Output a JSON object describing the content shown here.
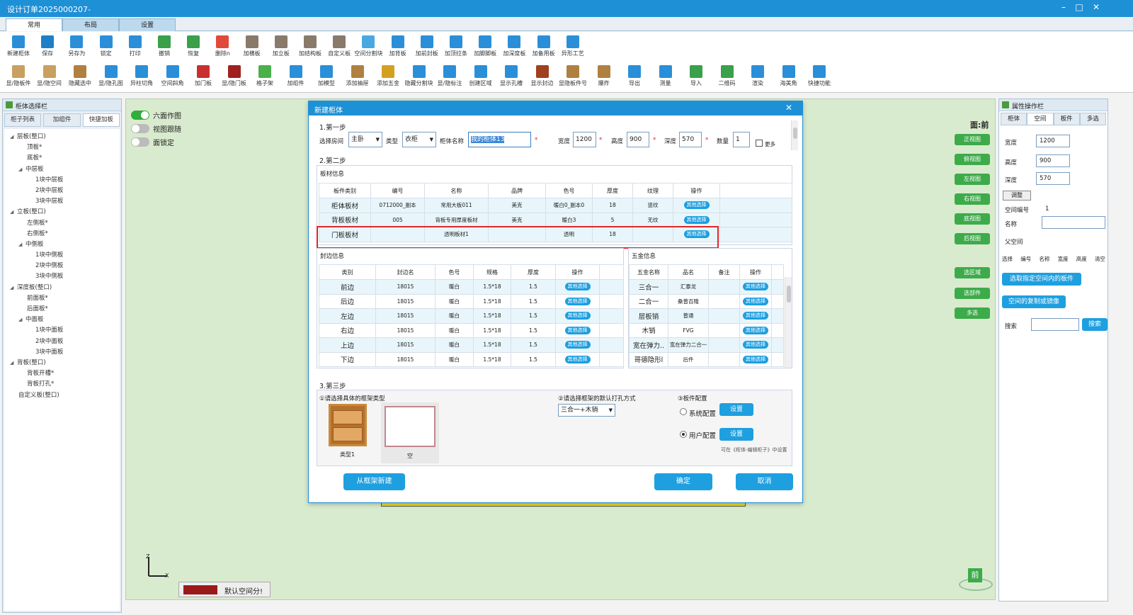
{
  "window": {
    "title": "设计订单2025000207-",
    "minimize": "–",
    "maximize": "□",
    "close": "✕"
  },
  "ribbon_tabs": [
    "常用",
    "布局",
    "设置"
  ],
  "toolbar_row1": [
    "新建柜体",
    "保存",
    "另存为",
    "锁定",
    "打印",
    "撤销",
    "恢复",
    "删除n",
    "加横板",
    "加立板",
    "加结构板",
    "自定义板",
    "空间分割块",
    "加背板",
    "加前封板",
    "加顶拉条",
    "加脚脚板",
    "加深度板",
    "加备用板",
    "异形工艺"
  ],
  "toolbar_row2": [
    "显/隐板件",
    "显/隐空间",
    "隐藏选中",
    "显/隐孔图",
    "异柱切角",
    "空间斜角",
    "加门板",
    "显/隐门板",
    "格子架",
    "加组件",
    "加模型",
    "添加抽屉",
    "添加五金",
    "隐藏分割块",
    "显/隐标注",
    "创建区域",
    "显示孔槽",
    "显示封边",
    "显隐板件号",
    "爆炸",
    "导出",
    "测量",
    "导入",
    "二维码",
    "渲染",
    "海美角",
    "快捷功能"
  ],
  "left_panel": {
    "title": "柜体选择栏",
    "tabs": [
      "柜子列表",
      "加组件",
      "快捷加板"
    ],
    "tree": [
      {
        "label": "层板(整口)",
        "lvl": 0,
        "ar": "◢"
      },
      {
        "label": "顶板*",
        "lvl": 2
      },
      {
        "label": "底板*",
        "lvl": 2
      },
      {
        "label": "中层板",
        "lvl": 1,
        "ar": "◢"
      },
      {
        "label": "1块中层板",
        "lvl": 3
      },
      {
        "label": "2块中层板",
        "lvl": 3
      },
      {
        "label": "3块中层板",
        "lvl": 3
      },
      {
        "label": "立板(整口)",
        "lvl": 0,
        "ar": "◢"
      },
      {
        "label": "左侧板*",
        "lvl": 2
      },
      {
        "label": "右侧板*",
        "lvl": 2
      },
      {
        "label": "中侧板",
        "lvl": 1,
        "ar": "◢"
      },
      {
        "label": "1块中侧板",
        "lvl": 3
      },
      {
        "label": "2块中侧板",
        "lvl": 3
      },
      {
        "label": "3块中侧板",
        "lvl": 3
      },
      {
        "label": "深度板(整口)",
        "lvl": 0,
        "ar": "◢"
      },
      {
        "label": "前面板*",
        "lvl": 2
      },
      {
        "label": "后面板*",
        "lvl": 2
      },
      {
        "label": "中面板",
        "lvl": 1,
        "ar": "◢"
      },
      {
        "label": "1块中面板",
        "lvl": 3
      },
      {
        "label": "2块中面板",
        "lvl": 3
      },
      {
        "label": "3块中面板",
        "lvl": 3
      },
      {
        "label": "背板(整口)",
        "lvl": 0,
        "ar": "◢"
      },
      {
        "label": "背板开槽*",
        "lvl": 2
      },
      {
        "label": "背板打孔*",
        "lvl": 2
      },
      {
        "label": "自定义板(整口)",
        "lvl": 1
      }
    ]
  },
  "view": {
    "switches": [
      {
        "label": "六面作图",
        "on": true
      },
      {
        "label": "视图跟随",
        "on": false
      },
      {
        "label": "面锁定",
        "on": false
      }
    ],
    "face_label": "面:前",
    "view_buttons": [
      "正视图",
      "俯视图",
      "左视图",
      "右视图",
      "底视图",
      "后视图"
    ],
    "select_buttons": [
      "选区域",
      "选部件",
      "多选"
    ],
    "axis_z": "Z",
    "axis_x": "X",
    "legend": "默认空间分!",
    "cube_label": "前"
  },
  "right_panel": {
    "title": "属性操作栏",
    "tabs": [
      "柜体",
      "空间",
      "板件",
      "多选"
    ],
    "width_label": "宽度",
    "width": "1200",
    "height_label": "高度",
    "height": "900",
    "depth_label": "深度",
    "depth": "570",
    "adjust_btn": "调整",
    "space_no_label": "空间编号",
    "space_no": "1",
    "name_label": "名称",
    "parent_label": "父空间",
    "cols": [
      "选择",
      "编号",
      "名称",
      "宽度",
      "高度",
      "清空"
    ],
    "btn_select_boards": "选取指定空间内的板件",
    "btn_copy": "空间的复制或镜像",
    "search_label": "搜索",
    "search_btn": "搜索"
  },
  "dialog": {
    "title": "新建柜体",
    "close": "✕",
    "step1": {
      "title": "1.第一步",
      "room_label": "选择房间",
      "room": "主卧",
      "type_label": "类型",
      "type": "衣柜",
      "name_label": "柜体名称",
      "name": "我的柜体13",
      "star": "*",
      "width_label": "宽度",
      "width": "1200",
      "height_label": "高度",
      "height": "900",
      "depth_label": "深度",
      "depth": "570",
      "qty_label": "数量",
      "qty": "1",
      "more_label": "更多"
    },
    "step2": {
      "title": "2.第二步",
      "board_title": "板材信息",
      "board_cols": [
        "板件类别",
        "编号",
        "名称",
        "品牌",
        "色号",
        "厚度",
        "纹理",
        "操作"
      ],
      "board_rows": [
        [
          "柜体板材",
          "0712000_副本",
          "常用大板011",
          "美克",
          "暖白0_副本0",
          "18",
          "竖纹",
          "其他选择"
        ],
        [
          "背板板材",
          "005",
          "背板专用厚度板材",
          "美克",
          "暖白3",
          "5",
          "无纹",
          "其他选择"
        ],
        [
          "门板板材",
          "",
          "透明板材1",
          "",
          "透明",
          "18",
          "",
          "其他选择"
        ]
      ],
      "edge_title": "封边信息",
      "edge_cols": [
        "类别",
        "封边名",
        "色号",
        "规格",
        "厚度",
        "操作"
      ],
      "edge_rows": [
        [
          "前边",
          "18015",
          "暖白",
          "1.5*18",
          "1.5",
          "其他选择"
        ],
        [
          "后边",
          "18015",
          "暖白",
          "1.5*18",
          "1.5",
          "其他选择"
        ],
        [
          "左边",
          "18015",
          "暖白",
          "1.5*18",
          "1.5",
          "其他选择"
        ],
        [
          "右边",
          "18015",
          "暖白",
          "1.5*18",
          "1.5",
          "其他选择"
        ],
        [
          "上边",
          "18015",
          "暖白",
          "1.5*18",
          "1.5",
          "其他选择"
        ],
        [
          "下边",
          "18015",
          "暖白",
          "1.5*18",
          "1.5",
          "其他选择"
        ]
      ],
      "hw_title": "五金信息",
      "hw_cols": [
        "五金名称",
        "品名",
        "备注",
        "操作"
      ],
      "hw_rows": [
        [
          "三合一",
          "汇泰龙",
          "",
          "其他选择"
        ],
        [
          "二合一",
          "桑普百隆",
          "",
          "其他选择"
        ],
        [
          "层板销",
          "普通",
          "",
          "其他选择"
        ],
        [
          "木销",
          "FVG",
          "",
          "其他选择"
        ],
        [
          "宽在弹力..",
          "宽在弹力二合一",
          "",
          "其他选择"
        ],
        [
          "哥德隐形l",
          "后件",
          "",
          "其他选择"
        ]
      ]
    },
    "step3": {
      "title": "3.第三步",
      "frame_label": "①请选择具体的框架类型",
      "frame_opts": [
        "类型1",
        "空"
      ],
      "hole_label": "②请选择框架的默认打孔方式",
      "hole_value": "三合一+木销",
      "config_label": "③板件配置",
      "sys_label": "系统配置",
      "user_label": "用户配置",
      "set_btn": "设置",
      "note": "可在《柜体-编辑柜子》中设置"
    },
    "btn_from_frame": "从框架新建",
    "btn_ok": "确定",
    "btn_cancel": "取消"
  }
}
